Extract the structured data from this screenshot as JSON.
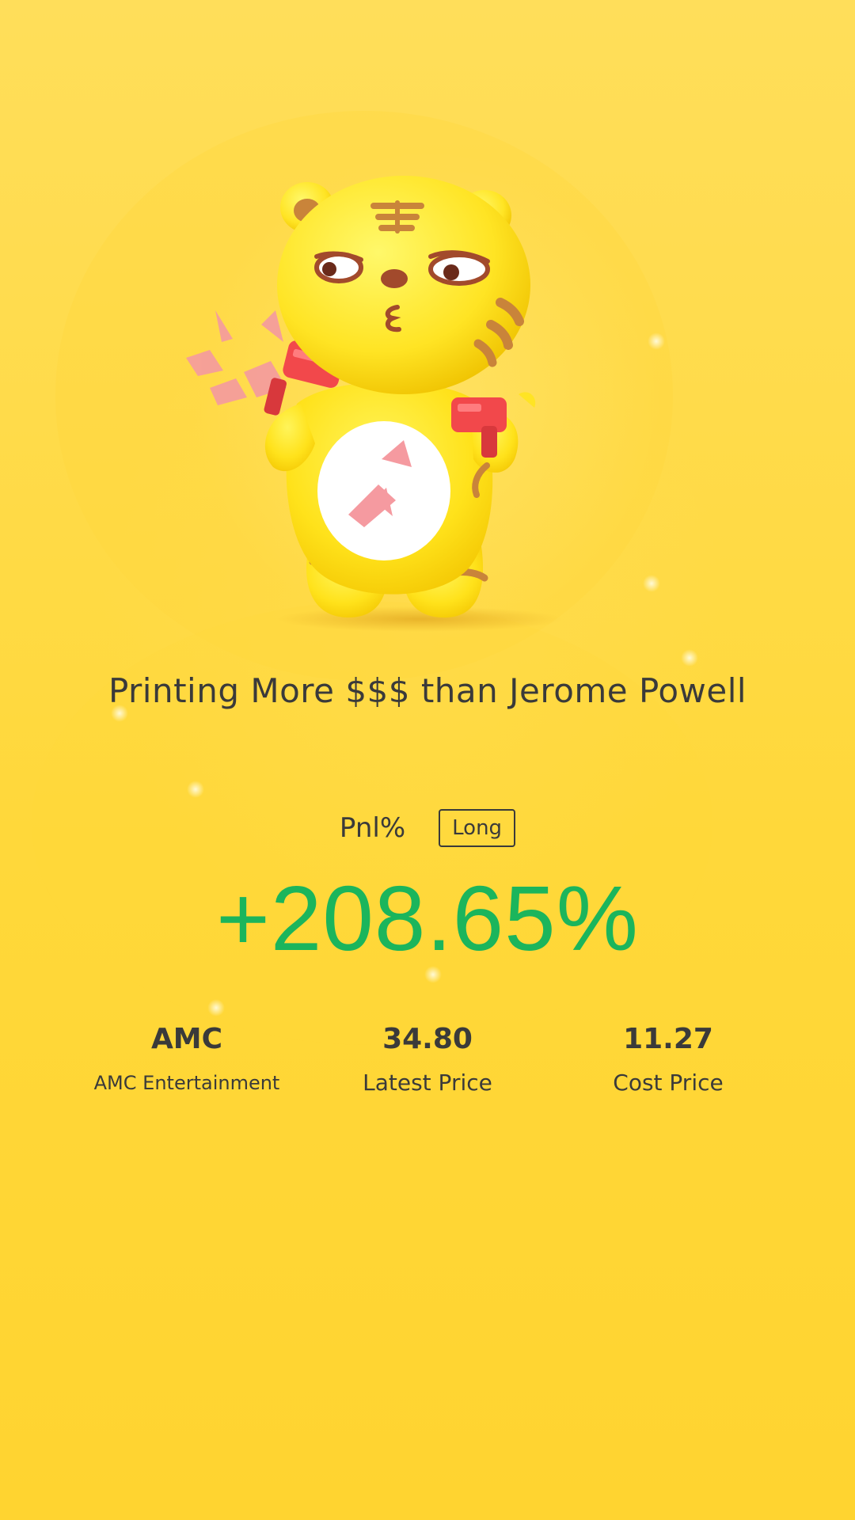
{
  "headline": "Printing More $$$ than Jerome Powell",
  "pnl": {
    "label": "Pnl%",
    "badge": "Long",
    "value": "+208.65%"
  },
  "stats": {
    "ticker": "AMC",
    "company": "AMC Entertainment",
    "latest_price": "34.80",
    "latest_price_label": "Latest Price",
    "cost_price": "11.27",
    "cost_price_label": "Cost Price"
  },
  "colors": {
    "background": "#FFD83A",
    "gain": "#1BB55C",
    "text": "#3A3A3A"
  },
  "illustration": {
    "icon": "tiger-mascot-money-gun-illustration"
  }
}
